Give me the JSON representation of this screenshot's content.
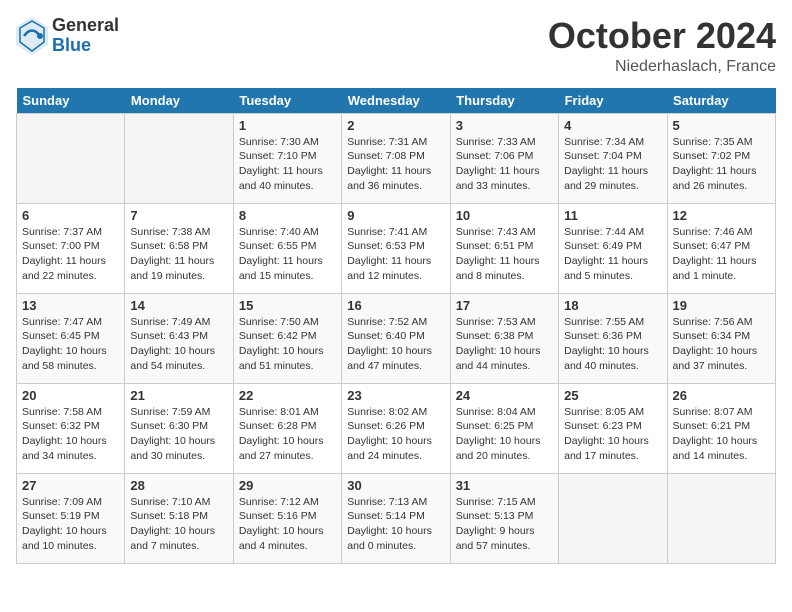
{
  "header": {
    "logo_general": "General",
    "logo_blue": "Blue",
    "month_title": "October 2024",
    "location": "Niederhaslach, France"
  },
  "weekdays": [
    "Sunday",
    "Monday",
    "Tuesday",
    "Wednesday",
    "Thursday",
    "Friday",
    "Saturday"
  ],
  "weeks": [
    [
      {
        "day": "",
        "empty": true
      },
      {
        "day": "",
        "empty": true
      },
      {
        "day": "1",
        "sunrise": "Sunrise: 7:30 AM",
        "sunset": "Sunset: 7:10 PM",
        "daylight": "Daylight: 11 hours and 40 minutes."
      },
      {
        "day": "2",
        "sunrise": "Sunrise: 7:31 AM",
        "sunset": "Sunset: 7:08 PM",
        "daylight": "Daylight: 11 hours and 36 minutes."
      },
      {
        "day": "3",
        "sunrise": "Sunrise: 7:33 AM",
        "sunset": "Sunset: 7:06 PM",
        "daylight": "Daylight: 11 hours and 33 minutes."
      },
      {
        "day": "4",
        "sunrise": "Sunrise: 7:34 AM",
        "sunset": "Sunset: 7:04 PM",
        "daylight": "Daylight: 11 hours and 29 minutes."
      },
      {
        "day": "5",
        "sunrise": "Sunrise: 7:35 AM",
        "sunset": "Sunset: 7:02 PM",
        "daylight": "Daylight: 11 hours and 26 minutes."
      }
    ],
    [
      {
        "day": "6",
        "sunrise": "Sunrise: 7:37 AM",
        "sunset": "Sunset: 7:00 PM",
        "daylight": "Daylight: 11 hours and 22 minutes."
      },
      {
        "day": "7",
        "sunrise": "Sunrise: 7:38 AM",
        "sunset": "Sunset: 6:58 PM",
        "daylight": "Daylight: 11 hours and 19 minutes."
      },
      {
        "day": "8",
        "sunrise": "Sunrise: 7:40 AM",
        "sunset": "Sunset: 6:55 PM",
        "daylight": "Daylight: 11 hours and 15 minutes."
      },
      {
        "day": "9",
        "sunrise": "Sunrise: 7:41 AM",
        "sunset": "Sunset: 6:53 PM",
        "daylight": "Daylight: 11 hours and 12 minutes."
      },
      {
        "day": "10",
        "sunrise": "Sunrise: 7:43 AM",
        "sunset": "Sunset: 6:51 PM",
        "daylight": "Daylight: 11 hours and 8 minutes."
      },
      {
        "day": "11",
        "sunrise": "Sunrise: 7:44 AM",
        "sunset": "Sunset: 6:49 PM",
        "daylight": "Daylight: 11 hours and 5 minutes."
      },
      {
        "day": "12",
        "sunrise": "Sunrise: 7:46 AM",
        "sunset": "Sunset: 6:47 PM",
        "daylight": "Daylight: 11 hours and 1 minute."
      }
    ],
    [
      {
        "day": "13",
        "sunrise": "Sunrise: 7:47 AM",
        "sunset": "Sunset: 6:45 PM",
        "daylight": "Daylight: 10 hours and 58 minutes."
      },
      {
        "day": "14",
        "sunrise": "Sunrise: 7:49 AM",
        "sunset": "Sunset: 6:43 PM",
        "daylight": "Daylight: 10 hours and 54 minutes."
      },
      {
        "day": "15",
        "sunrise": "Sunrise: 7:50 AM",
        "sunset": "Sunset: 6:42 PM",
        "daylight": "Daylight: 10 hours and 51 minutes."
      },
      {
        "day": "16",
        "sunrise": "Sunrise: 7:52 AM",
        "sunset": "Sunset: 6:40 PM",
        "daylight": "Daylight: 10 hours and 47 minutes."
      },
      {
        "day": "17",
        "sunrise": "Sunrise: 7:53 AM",
        "sunset": "Sunset: 6:38 PM",
        "daylight": "Daylight: 10 hours and 44 minutes."
      },
      {
        "day": "18",
        "sunrise": "Sunrise: 7:55 AM",
        "sunset": "Sunset: 6:36 PM",
        "daylight": "Daylight: 10 hours and 40 minutes."
      },
      {
        "day": "19",
        "sunrise": "Sunrise: 7:56 AM",
        "sunset": "Sunset: 6:34 PM",
        "daylight": "Daylight: 10 hours and 37 minutes."
      }
    ],
    [
      {
        "day": "20",
        "sunrise": "Sunrise: 7:58 AM",
        "sunset": "Sunset: 6:32 PM",
        "daylight": "Daylight: 10 hours and 34 minutes."
      },
      {
        "day": "21",
        "sunrise": "Sunrise: 7:59 AM",
        "sunset": "Sunset: 6:30 PM",
        "daylight": "Daylight: 10 hours and 30 minutes."
      },
      {
        "day": "22",
        "sunrise": "Sunrise: 8:01 AM",
        "sunset": "Sunset: 6:28 PM",
        "daylight": "Daylight: 10 hours and 27 minutes."
      },
      {
        "day": "23",
        "sunrise": "Sunrise: 8:02 AM",
        "sunset": "Sunset: 6:26 PM",
        "daylight": "Daylight: 10 hours and 24 minutes."
      },
      {
        "day": "24",
        "sunrise": "Sunrise: 8:04 AM",
        "sunset": "Sunset: 6:25 PM",
        "daylight": "Daylight: 10 hours and 20 minutes."
      },
      {
        "day": "25",
        "sunrise": "Sunrise: 8:05 AM",
        "sunset": "Sunset: 6:23 PM",
        "daylight": "Daylight: 10 hours and 17 minutes."
      },
      {
        "day": "26",
        "sunrise": "Sunrise: 8:07 AM",
        "sunset": "Sunset: 6:21 PM",
        "daylight": "Daylight: 10 hours and 14 minutes."
      }
    ],
    [
      {
        "day": "27",
        "sunrise": "Sunrise: 7:09 AM",
        "sunset": "Sunset: 5:19 PM",
        "daylight": "Daylight: 10 hours and 10 minutes."
      },
      {
        "day": "28",
        "sunrise": "Sunrise: 7:10 AM",
        "sunset": "Sunset: 5:18 PM",
        "daylight": "Daylight: 10 hours and 7 minutes."
      },
      {
        "day": "29",
        "sunrise": "Sunrise: 7:12 AM",
        "sunset": "Sunset: 5:16 PM",
        "daylight": "Daylight: 10 hours and 4 minutes."
      },
      {
        "day": "30",
        "sunrise": "Sunrise: 7:13 AM",
        "sunset": "Sunset: 5:14 PM",
        "daylight": "Daylight: 10 hours and 0 minutes."
      },
      {
        "day": "31",
        "sunrise": "Sunrise: 7:15 AM",
        "sunset": "Sunset: 5:13 PM",
        "daylight": "Daylight: 9 hours and 57 minutes."
      },
      {
        "day": "",
        "empty": true
      },
      {
        "day": "",
        "empty": true
      }
    ]
  ]
}
